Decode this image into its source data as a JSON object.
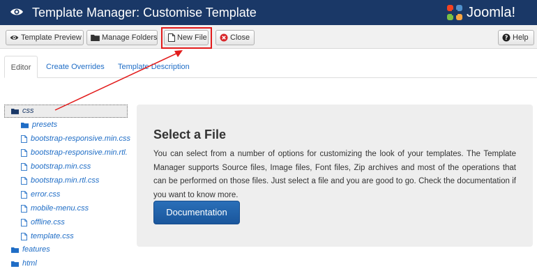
{
  "header": {
    "title": "Template Manager: Customise Template",
    "brand": "Joomla!",
    "background_color": "#1a3867",
    "title_icon": "eye-icon",
    "brand_icon": "joomla-logo-icon"
  },
  "toolbar": {
    "template_preview": {
      "label": "Template Preview",
      "icon": "eye-icon"
    },
    "manage_folders": {
      "label": "Manage Folders",
      "icon": "folder-icon"
    },
    "new_file": {
      "label": "New File",
      "icon": "file-icon"
    },
    "close": {
      "label": "Close",
      "icon": "close-circle-icon"
    },
    "help": {
      "label": "Help",
      "icon": "question-circle-icon"
    }
  },
  "annotation": {
    "highlight_color": "#e21b1b"
  },
  "tabs": [
    {
      "label": "Editor",
      "active": true
    },
    {
      "label": "Create Overrides",
      "active": false
    },
    {
      "label": "Template Description",
      "active": false
    }
  ],
  "tree": {
    "root_folder": "css",
    "files": [
      {
        "name": "presets",
        "type": "folder"
      },
      {
        "name": "bootstrap-responsive.min.css",
        "type": "file"
      },
      {
        "name": "bootstrap-responsive.min.rtl.css",
        "type": "file"
      },
      {
        "name": "bootstrap.min.css",
        "type": "file"
      },
      {
        "name": "bootstrap.min.rtl.css",
        "type": "file"
      },
      {
        "name": "error.css",
        "type": "file"
      },
      {
        "name": "mobile-menu.css",
        "type": "file"
      },
      {
        "name": "offline.css",
        "type": "file"
      },
      {
        "name": "template.css",
        "type": "file"
      }
    ],
    "siblings": [
      {
        "name": "features",
        "type": "folder"
      },
      {
        "name": "html",
        "type": "folder"
      }
    ]
  },
  "panel": {
    "heading": "Select a File",
    "description": "You can select from a number of options for customizing the look of your templates. The Template Manager supports Source files, Image files, Font files, Zip archives and most of the operations that can be performed on those files. Just select a file and you are good to go. Check the documentation if you want to know more.",
    "button_label": "Documentation"
  },
  "colors": {
    "link": "#1f6dc6",
    "accent_button": "#1f5fa8"
  }
}
